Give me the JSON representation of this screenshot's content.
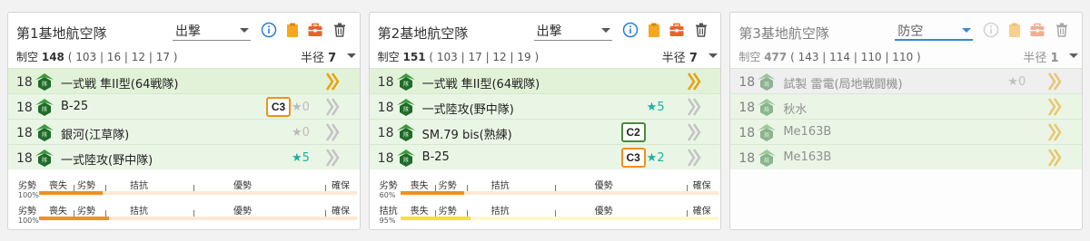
{
  "panels": [
    {
      "title": "第1基地航空隊",
      "mode": "出撃",
      "air_label": "制空",
      "air_value": "148",
      "air_detail": "( 103 | 16 | 12 | 17 )",
      "radius_label": "半径",
      "radius_value": "7",
      "squadrons": [
        {
          "count": "18",
          "name": "一式戦 隼II型(64戦隊)",
          "proficiency": "",
          "improvement": "",
          "chevron": "gold"
        },
        {
          "count": "18",
          "name": "B-25",
          "proficiency": "C3",
          "improvement": "0",
          "chevron": "grey"
        },
        {
          "count": "18",
          "name": "銀河(江草隊)",
          "proficiency": "",
          "improvement": "0",
          "chevron": "grey"
        },
        {
          "count": "18",
          "name": "一式陸攻(野中隊)",
          "proficiency": "",
          "improvement": "5",
          "chevron": "grey"
        }
      ],
      "bars": [
        {
          "label": "劣勢",
          "percent": "100%",
          "fill": 0.2,
          "color": "orange"
        },
        {
          "label": "劣勢",
          "percent": "100%",
          "fill": 0.22,
          "color": "orange"
        }
      ]
    },
    {
      "title": "第2基地航空隊",
      "mode": "出撃",
      "air_label": "制空",
      "air_value": "151",
      "air_detail": "( 103 | 17 | 12 | 19 )",
      "radius_label": "半径",
      "radius_value": "7",
      "squadrons": [
        {
          "count": "18",
          "name": "一式戦 隼II型(64戦隊)",
          "proficiency": "",
          "improvement": "",
          "chevron": "gold"
        },
        {
          "count": "18",
          "name": "一式陸攻(野中隊)",
          "proficiency": "",
          "improvement": "5",
          "chevron": "grey"
        },
        {
          "count": "18",
          "name": "SM.79 bis(熟練)",
          "proficiency": "C2",
          "improvement": "",
          "chevron": "grey"
        },
        {
          "count": "18",
          "name": "B-25",
          "proficiency": "C3",
          "improvement": "2",
          "chevron": "grey"
        }
      ],
      "bars": [
        {
          "label": "劣勢",
          "percent": "60%",
          "fill": 0.2,
          "color": "orange"
        },
        {
          "label": "拮抗",
          "percent": "95%",
          "fill": 0.22,
          "color": "yellow"
        }
      ]
    },
    {
      "title": "第3基地航空隊",
      "mode": "防空",
      "air_label": "制空",
      "air_value": "477",
      "air_detail": "( 143 | 114 | 110 | 110 )",
      "radius_label": "半径",
      "radius_value": "1",
      "squadrons": [
        {
          "count": "18",
          "name": "試製 雷電(局地戦闘機)",
          "proficiency": "",
          "improvement": "0",
          "chevron": "gold"
        },
        {
          "count": "18",
          "name": "秋水",
          "proficiency": "",
          "improvement": "",
          "chevron": "gold"
        },
        {
          "count": "18",
          "name": "Me163B",
          "proficiency": "",
          "improvement": "",
          "chevron": "gold"
        },
        {
          "count": "18",
          "name": "Me163B",
          "proficiency": "",
          "improvement": "",
          "chevron": "gold"
        }
      ],
      "bars": []
    }
  ],
  "scale_labels": {
    "loss": "喪失",
    "inferior": "劣勢",
    "parity": "拮抗",
    "superior": "優勢",
    "supremacy": "確保"
  },
  "icons": {
    "info": "info-circle-icon",
    "clipboard": "clipboard-icon",
    "toolbox": "toolbox-icon",
    "trash": "trash-icon",
    "plane": "fighter-plane-icon",
    "star": "improvement-star-icon",
    "chevron": "double-chevron-right-icon"
  },
  "colors": {
    "orange": "#f0901e",
    "teal": "#19b3a1",
    "green_row": "#eaf6e5",
    "blue": "#2a7fd4"
  }
}
